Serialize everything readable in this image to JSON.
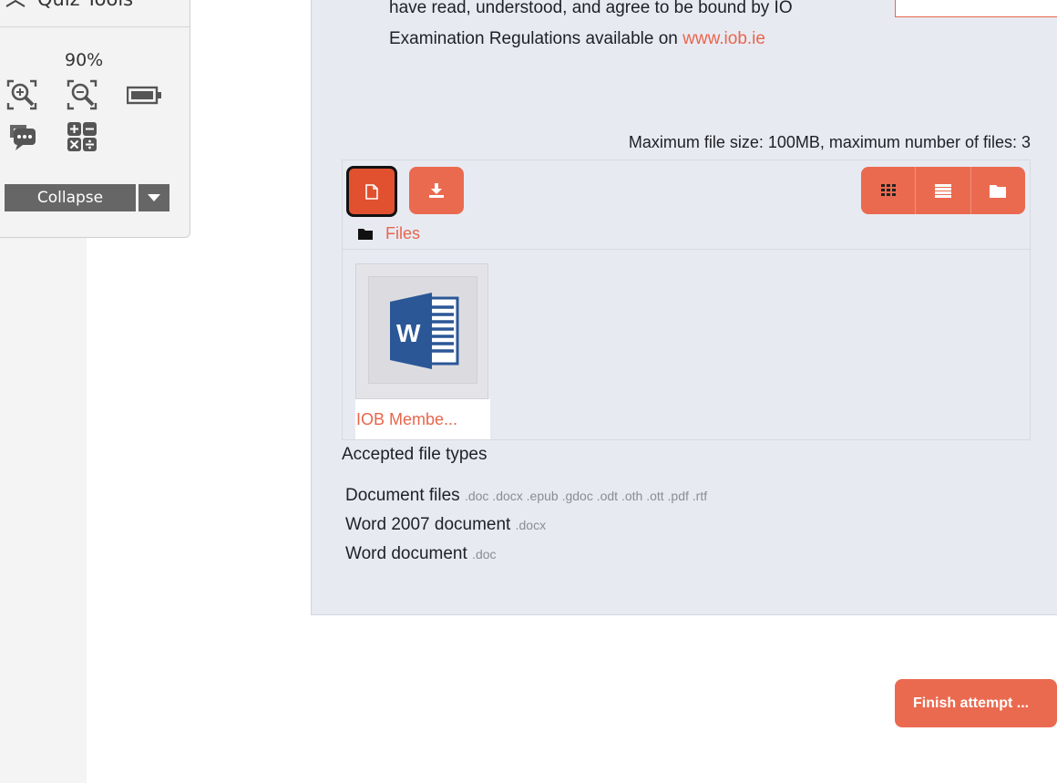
{
  "quiz_tools": {
    "title": "Quiz Tools",
    "zoom_level": "90%",
    "collapse_label": "Collapse",
    "buttons": [
      "zoom-in-icon",
      "zoom-out-icon",
      "battery-icon",
      "chat-icon",
      "calculator-icon"
    ]
  },
  "declaration": {
    "line1": "have read, understood, and agree to be bound by IO",
    "line2_prefix": "Examination Regulations available on ",
    "link": "www.iob.ie"
  },
  "file_manager": {
    "max_info": "Maximum file size: 100MB, maximum number of files: 3",
    "breadcrumb": "Files",
    "file_name": "IOB Membe...",
    "buttons": [
      "add-file-icon",
      "download-icon",
      "grid-view-icon",
      "list-view-icon",
      "folder-view-icon"
    ]
  },
  "accepted": {
    "title": "Accepted file types",
    "types": [
      {
        "name": "Document files",
        "ext": ".doc .docx .epub .gdoc .odt .oth .ott .pdf .rtf"
      },
      {
        "name": "Word 2007 document",
        "ext": ".docx"
      },
      {
        "name": "Word document",
        "ext": ".doc"
      }
    ]
  },
  "finish_label": "Finish attempt ...",
  "colors": {
    "accent": "#ea6a50",
    "link": "#e8664c",
    "card": "#e8eaf2",
    "word_blue": "#2b5797"
  }
}
